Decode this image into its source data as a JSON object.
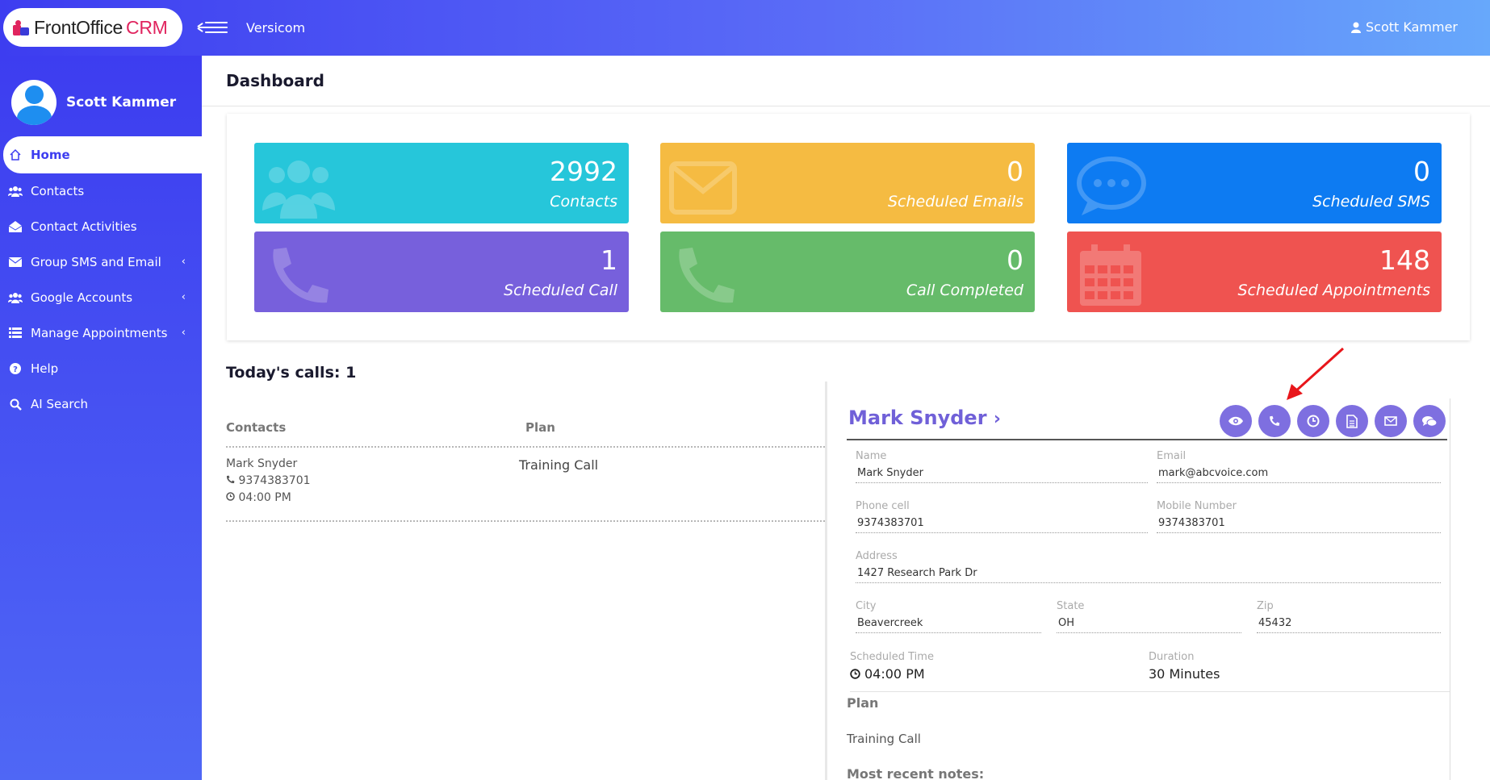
{
  "header": {
    "logo_front": "FrontOffice",
    "logo_crm": "CRM",
    "company": "Versicom",
    "user": "Scott Kammer",
    "gradient_start": "#3d3df0",
    "gradient_end": "#67a8fb"
  },
  "sidebar": {
    "profile_name": "Scott Kammer",
    "items": [
      {
        "label": "Home",
        "icon": "home-icon"
      },
      {
        "label": "Contacts",
        "icon": "users-icon"
      },
      {
        "label": "Contact Activities",
        "icon": "envelope-open-icon"
      },
      {
        "label": "Group SMS and Email",
        "icon": "envelope-icon"
      },
      {
        "label": "Google Accounts",
        "icon": "users-icon"
      },
      {
        "label": "Manage Appointments",
        "icon": "list-icon"
      },
      {
        "label": "Help",
        "icon": "question-icon"
      },
      {
        "label": "AI Search",
        "icon": "search-icon"
      }
    ]
  },
  "page": {
    "title": "Dashboard"
  },
  "stats": [
    {
      "value": "2992",
      "label": "Contacts",
      "color": "#26c6da",
      "icon": "users-icon"
    },
    {
      "value": "0",
      "label": "Scheduled Emails",
      "color": "#f5bb42",
      "icon": "envelope-icon"
    },
    {
      "value": "0",
      "label": "Scheduled SMS",
      "color": "#0d7bf2",
      "icon": "comments-icon"
    },
    {
      "value": "1",
      "label": "Scheduled Call",
      "color": "#7760dc",
      "icon": "phone-icon"
    },
    {
      "value": "0",
      "label": "Call Completed",
      "color": "#66bb6a",
      "icon": "phone-icon"
    },
    {
      "value": "148",
      "label": "Scheduled Appointments",
      "color": "#ef5350",
      "icon": "calendar-icon"
    }
  ],
  "calls": {
    "title": "Today's calls: 1",
    "col_contacts": "Contacts",
    "col_plan": "Plan",
    "rows": [
      {
        "name": "Mark Snyder",
        "phone": "9374383701",
        "time": "04:00 PM",
        "plan": "Training Call"
      }
    ]
  },
  "detail": {
    "name": "Mark Snyder",
    "name_label": "Name",
    "name_value": "Mark Snyder",
    "email_label": "Email",
    "email_value": "mark@abcvoice.com",
    "phone_label": "Phone cell",
    "phone_value": "9374383701",
    "mobile_label": "Mobile Number",
    "mobile_value": "9374383701",
    "address_label": "Address",
    "address_value": "1427 Research Park Dr",
    "city_label": "City",
    "city_value": "Beavercreek",
    "state_label": "State",
    "state_value": "OH",
    "zip_label": "Zip",
    "zip_value": "45432",
    "sched_label": "Scheduled Time",
    "sched_value": "04:00 PM",
    "duration_label": "Duration",
    "duration_value": "30 Minutes",
    "plan_label": "Plan",
    "plan_value": "Training Call",
    "notes_label": "Most recent notes:",
    "actions": [
      "eye-icon",
      "phone-icon",
      "clock-icon",
      "document-icon",
      "envelope-icon",
      "comments-icon"
    ],
    "accent": "#7e6fe0"
  },
  "annotation_color": "#e8161b"
}
